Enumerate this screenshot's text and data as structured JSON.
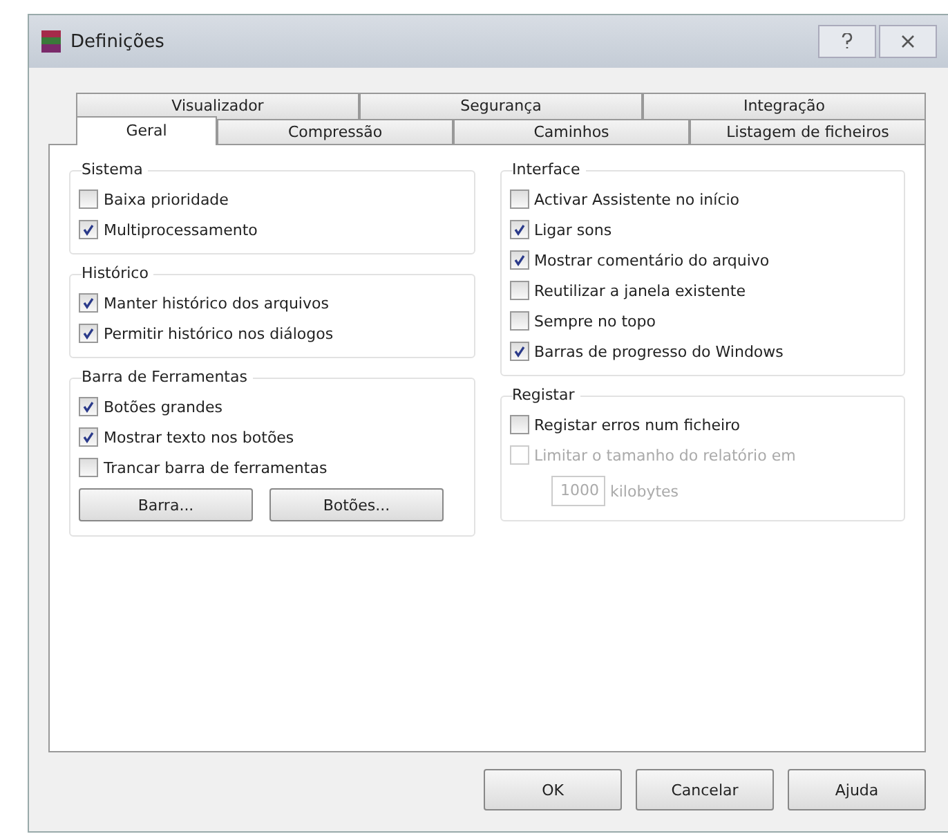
{
  "window": {
    "title": "Definições"
  },
  "tab_rows": [
    [
      {
        "label": "Visualizador",
        "selected": false
      },
      {
        "label": "Segurança",
        "selected": false
      },
      {
        "label": "Integração",
        "selected": false
      }
    ],
    [
      {
        "label": "Geral",
        "selected": true
      },
      {
        "label": "Compressão",
        "selected": false
      },
      {
        "label": "Caminhos",
        "selected": false
      },
      {
        "label": "Listagem de ficheiros",
        "selected": false
      }
    ]
  ],
  "columns": [
    [
      {
        "title": "Sistema",
        "items": [
          {
            "kind": "checkbox",
            "label": "Baixa prioridade",
            "checked": false,
            "disabled": false
          },
          {
            "kind": "checkbox",
            "label": "Multiprocessamento",
            "checked": true,
            "disabled": false
          }
        ]
      },
      {
        "title": "Histórico",
        "items": [
          {
            "kind": "checkbox",
            "label": "Manter histórico dos arquivos",
            "checked": true,
            "disabled": false
          },
          {
            "kind": "checkbox",
            "label": "Permitir histórico nos diálogos",
            "checked": true,
            "disabled": false
          }
        ]
      },
      {
        "title": "Barra de Ferramentas",
        "items": [
          {
            "kind": "checkbox",
            "label": "Botões grandes",
            "checked": true,
            "disabled": false
          },
          {
            "kind": "checkbox",
            "label": "Mostrar texto nos botões",
            "checked": true,
            "disabled": false
          },
          {
            "kind": "checkbox",
            "label": "Trancar barra de ferramentas",
            "checked": false,
            "disabled": false
          },
          {
            "kind": "buttons",
            "buttons": [
              "Barra...",
              "Botões..."
            ]
          }
        ]
      }
    ],
    [
      {
        "title": "Interface",
        "items": [
          {
            "kind": "checkbox",
            "label": "Activar Assistente no início",
            "checked": false,
            "disabled": false
          },
          {
            "kind": "checkbox",
            "label": "Ligar sons",
            "checked": true,
            "disabled": false
          },
          {
            "kind": "checkbox",
            "label": "Mostrar comentário do arquivo",
            "checked": true,
            "disabled": false
          },
          {
            "kind": "checkbox",
            "label": "Reutilizar a janela existente",
            "checked": false,
            "disabled": false
          },
          {
            "kind": "checkbox",
            "label": "Sempre no topo",
            "checked": false,
            "disabled": false
          },
          {
            "kind": "checkbox",
            "label": "Barras de progresso do Windows",
            "checked": true,
            "disabled": false
          }
        ]
      },
      {
        "title": "Registar",
        "items": [
          {
            "kind": "checkbox",
            "label": "Registar erros num ficheiro",
            "checked": false,
            "disabled": false
          },
          {
            "kind": "checkbox",
            "label": "Limitar o tamanho do relatório em",
            "checked": false,
            "disabled": true
          },
          {
            "kind": "number",
            "value": "1000",
            "unit": "kilobytes",
            "disabled": true
          }
        ]
      }
    ]
  ],
  "buttons": [
    "OK",
    "Cancelar",
    "Ajuda"
  ]
}
